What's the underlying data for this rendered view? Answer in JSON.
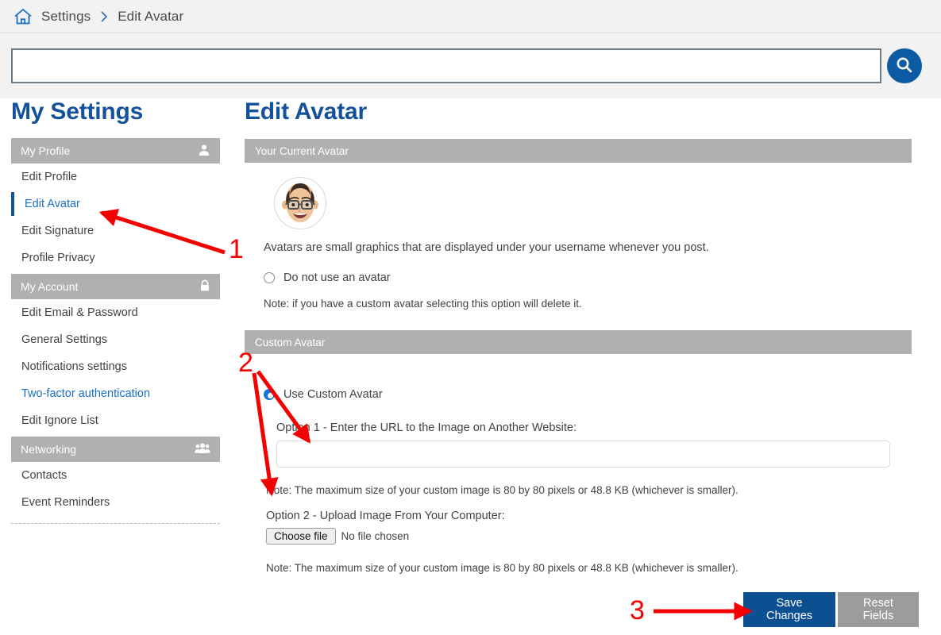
{
  "breadcrumb": {
    "home_icon": "home-icon",
    "items": [
      "Settings",
      "Edit Avatar"
    ],
    "separator": "chevron-right-icon"
  },
  "search": {
    "value": "",
    "placeholder": "",
    "button_icon": "search-icon"
  },
  "sidebar": {
    "title": "My Settings",
    "sections": [
      {
        "header": "My Profile",
        "icon": "user-icon",
        "items": [
          {
            "label": "Edit Profile",
            "state": "normal"
          },
          {
            "label": "Edit Avatar",
            "state": "active"
          },
          {
            "label": "Edit Signature",
            "state": "normal"
          },
          {
            "label": "Profile Privacy",
            "state": "normal"
          }
        ]
      },
      {
        "header": "My Account",
        "icon": "lock-icon",
        "items": [
          {
            "label": "Edit Email & Password",
            "state": "normal"
          },
          {
            "label": "General Settings",
            "state": "normal"
          },
          {
            "label": "Notifications settings",
            "state": "normal"
          },
          {
            "label": "Two-factor authentication",
            "state": "link"
          },
          {
            "label": "Edit Ignore List",
            "state": "normal"
          }
        ]
      },
      {
        "header": "Networking",
        "icon": "group-icon",
        "items": [
          {
            "label": "Contacts",
            "state": "normal"
          },
          {
            "label": "Event Reminders",
            "state": "normal"
          }
        ]
      }
    ]
  },
  "main": {
    "title": "Edit Avatar",
    "current_avatar_panel": {
      "header": "Your Current Avatar",
      "avatar_alt": "memoji-avatar",
      "description": "Avatars are small graphics that are displayed under your username whenever you post.",
      "no_avatar_option": {
        "label": "Do not use an avatar",
        "checked": false
      },
      "no_avatar_note": "Note: if you have a custom avatar selecting this option will delete it."
    },
    "custom_avatar_panel": {
      "header": "Custom Avatar",
      "use_custom_option": {
        "label": "Use Custom Avatar",
        "checked": true
      },
      "option1_label": "Option 1 - Enter the URL to the Image on Another Website:",
      "url_value": "",
      "url_placeholder": "",
      "option1_note": "Note: The maximum size of your custom image is 80 by 80 pixels or 48.8 KB (whichever is smaller).",
      "option2_label": "Option 2 - Upload Image From Your Computer:",
      "choose_file_label": "Choose file",
      "file_status": "No file chosen",
      "option2_note": "Note: The maximum size of your custom image is 80 by 80 pixels or 48.8 KB (whichever is smaller)."
    },
    "actions": {
      "save_label": "Save Changes",
      "reset_label": "Reset Fields"
    }
  },
  "annotations": {
    "marker1": "1",
    "marker2": "2",
    "marker3": "3",
    "color": "#f50000"
  },
  "colors": {
    "accent_blue": "#14519b",
    "link_blue": "#1a6fc4",
    "panel_gray": "#b0b0b0",
    "primary_button": "#0d5092",
    "secondary_button": "#9c9c9c",
    "page_bg": "#ffffff",
    "bar_bg": "#f2f2f2"
  }
}
